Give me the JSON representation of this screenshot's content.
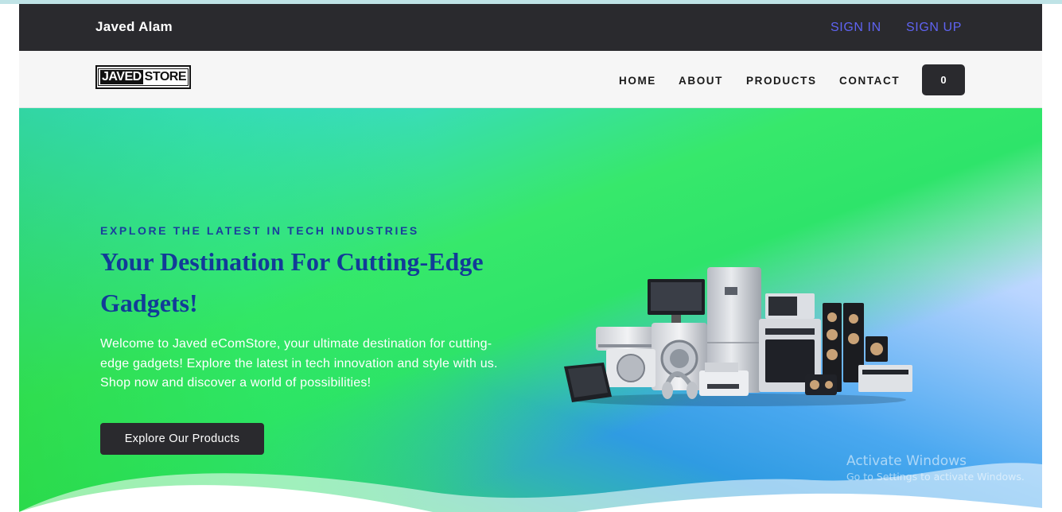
{
  "topbar": {
    "brand": "Javed Alam",
    "sign_in": "SIGN IN",
    "sign_up": "SIGN UP"
  },
  "navbar": {
    "logo_part1": "JAVED",
    "logo_part2": "STORE",
    "items": [
      {
        "label": "HOME"
      },
      {
        "label": "ABOUT"
      },
      {
        "label": "PRODUCTS"
      },
      {
        "label": "CONTACT"
      }
    ],
    "cart_count": "0"
  },
  "hero": {
    "eyebrow": "EXPLORE THE LATEST IN TECH INDUSTRIES",
    "headline": "Your Destination For Cutting-Edge Gadgets!",
    "intro": "Welcome to Javed eComStore, your ultimate destination for cutting-edge gadgets! Explore the latest in tech innovation and style with us. Shop now and discover a world of possibilities!",
    "cta": "Explore Our Products",
    "image_icon": "appliances-collage"
  },
  "os_watermark": {
    "title": "Activate Windows",
    "subtitle": "Go to Settings to activate Windows."
  },
  "colors": {
    "dark": "#2a2a2e",
    "link": "#5f63f2",
    "heading_blue": "#123b98"
  }
}
